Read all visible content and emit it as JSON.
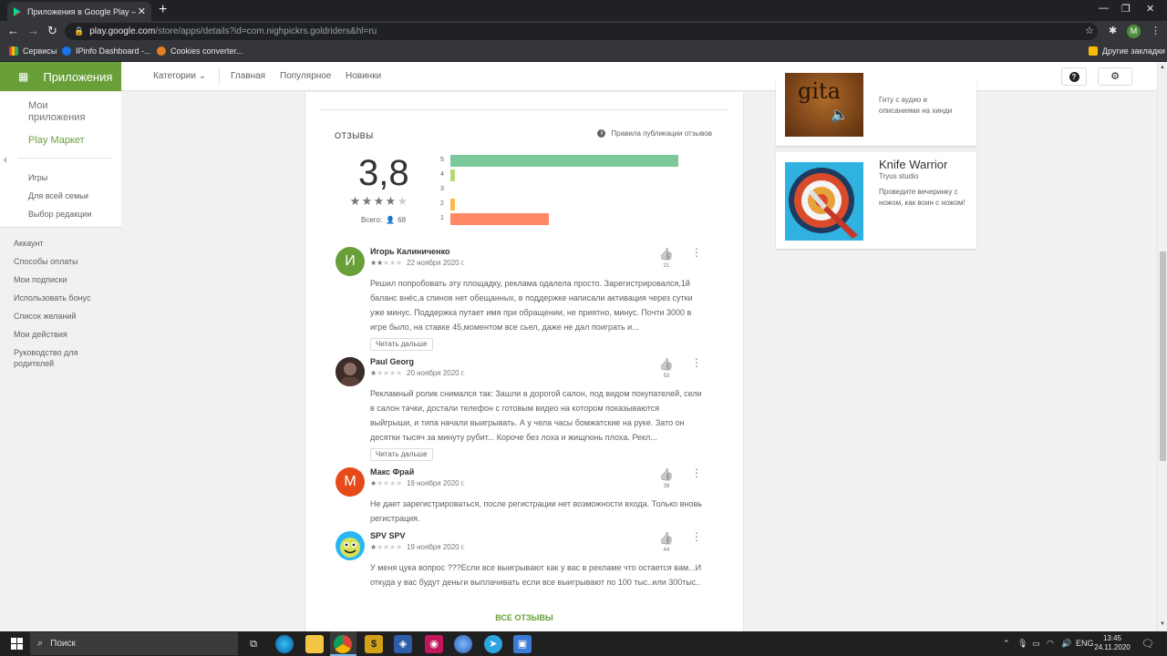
{
  "browser": {
    "tab_title": "Приложения в Google Play – Go",
    "new_tab_label": "+",
    "url_host": "play.google.com",
    "url_path": "/store/apps/details?id=com.nighpickrs.goldriders&hl=ru",
    "profile_initial": "M",
    "bookmarks": [
      "Сервисы",
      "IPinfo Dashboard -...",
      "Cookies converter..."
    ],
    "other_bookmarks": "Другие закладки"
  },
  "header": {
    "apps_label": "Приложения",
    "nav": [
      "Категории",
      "Главная",
      "Популярное",
      "Новинки"
    ],
    "help_icon": "help-icon",
    "settings_icon": "gear-icon",
    "accent_color": "#689f38"
  },
  "sidebar": {
    "my_apps": "Мои приложения",
    "play_market": "Play Маркет",
    "sub_items": [
      "Игры",
      "Для всей семьи",
      "Выбор редакции"
    ],
    "account_items": [
      "Аккаунт",
      "Способы оплаты",
      "Мои подписки",
      "Использовать бонус",
      "Список желаний",
      "Мои действия",
      "Руководство для родителей"
    ]
  },
  "reviews": {
    "heading": "ОТЗЫВЫ",
    "policy_link": "Правила публикации отзывов",
    "score": "3,8",
    "score_value": 3.8,
    "total_label": "Всего:",
    "total_count": "68",
    "histogram": [
      {
        "label": "5",
        "fraction": 0.97,
        "color": "#7bc89a"
      },
      {
        "label": "4",
        "fraction": 0.02,
        "color": "#b4d977"
      },
      {
        "label": "3",
        "fraction": 0.0,
        "color": "#ffd54f"
      },
      {
        "label": "2",
        "fraction": 0.02,
        "color": "#ffb74d"
      },
      {
        "label": "1",
        "fraction": 0.42,
        "color": "#ff8a65"
      }
    ],
    "items": [
      {
        "name": "Игорь Калиниченко",
        "avatar_letter": "И",
        "avatar_color": "#689f38",
        "stars": 2,
        "date": "22 ноября 2020 г.",
        "text": "Решил попробовать эту площадку, реклама одалела просто. Зарегистрировался,1й баланс внёс,а спинов нет обещанных, в поддержке написали активация через сутки уже минус. Поддержка путает имя при обращении, не приятно, минус. Почти 3000 в игре было, на ставке 45,моментом все сьел, даже не дал поиграть и...",
        "more": "Читать дальше",
        "likes": "21"
      },
      {
        "name": "Paul Georg",
        "avatar_letter": "",
        "avatar_color": "#4a3b36",
        "stars": 1,
        "date": "20 ноября 2020 г.",
        "text": "Рекламный ролик снимался так: Зашли в дорогой салон, под видом покупателей, сели в салон тачки, достали телефон с готовым видео на котором показываются выйгрыши, и типа начали выигрывать. А у чела часы бомжатские на руке. Зато он десятки тысяч за минуту рубит... Короче без лоха и жищгюнь плоха. Рекл...",
        "more": "Читать дальше",
        "likes": "53"
      },
      {
        "name": "Макс Фрай",
        "avatar_letter": "М",
        "avatar_color": "#e64a19",
        "stars": 1,
        "date": "19 ноября 2020 г.",
        "text": "Не дает зарегистрироваться, после регистрации нет возможности входа. Только вновь регистрация.",
        "more": "",
        "likes": "39"
      },
      {
        "name": "SPV SPV",
        "avatar_letter": "",
        "avatar_color": "#29b6f6",
        "stars": 1,
        "date": "19 ноября 2020 г.",
        "text": "У меня цука вопрос ???Если все выигрывают как у вас в рекламе что остается вам...И откуда у вас будут деньги выплачивать если все выигрывают по 100 тыс..или 300тыс..",
        "more": "",
        "likes": "44"
      }
    ],
    "all_reviews": "ВСЕ ОТЗЫВЫ"
  },
  "right_column": {
    "card1": {
      "thumb_text": "gita",
      "desc": "Гиту с аудио и описаниями на хинди"
    },
    "card2": {
      "title": "Knife Warrior",
      "developer": "Tryus studio",
      "desc": "Проведите вечеринку с ножом, как воин с ножом!"
    }
  },
  "taskbar": {
    "search": "Поиск",
    "lang": "ENG",
    "time": "13:45",
    "date": "24.11.2020"
  }
}
